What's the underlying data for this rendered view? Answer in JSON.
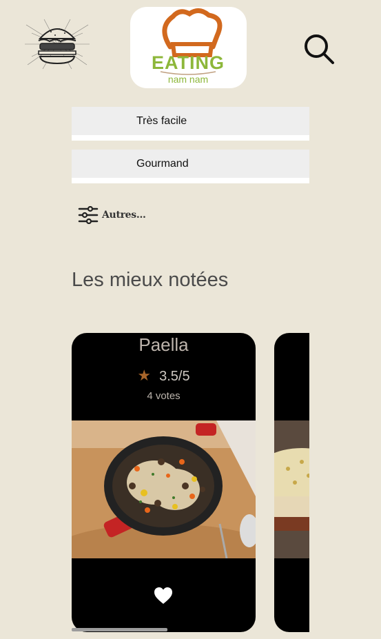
{
  "header": {
    "brand_name": "EATING",
    "brand_tagline": "nam nam",
    "logo_icon": "burger-sketch-icon",
    "search_icon": "search-icon"
  },
  "filters": [
    {
      "value": "Très facile"
    },
    {
      "value": "Gourmand"
    }
  ],
  "more_filters": {
    "label": "Autres...",
    "icon": "sliders-icon"
  },
  "section": {
    "title": "Les mieux notées"
  },
  "recipes": [
    {
      "name": "Paella",
      "rating": "3.5/5",
      "votes": "4 votes",
      "favorite_icon": "heart-icon"
    }
  ],
  "colors": {
    "background": "#ebe6d8",
    "card": "#000000",
    "star": "#a8652a",
    "brand_orange": "#d2691e",
    "brand_green": "#8db73a"
  }
}
